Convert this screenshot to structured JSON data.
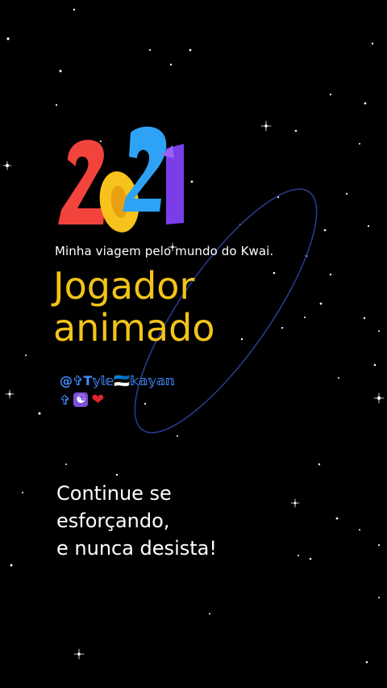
{
  "logo": {
    "year_digits": [
      "2",
      "0",
      "2",
      "1"
    ],
    "colors": [
      "#f2433d",
      "#f7c21c",
      "#2ea3f5",
      "#7a3ee8"
    ]
  },
  "header": {
    "subtitle": "Minha viagem pelo mundo do Kwai."
  },
  "title": {
    "line1": "Jogador",
    "line2": "animado"
  },
  "user": {
    "handle": "@✞T𝕪𝕝𝕖🇪🇪𝕜𝕒𝕪𝕒𝕟",
    "icon_names": [
      "cross-icon",
      "yin-yang-icon",
      "heart-icon"
    ],
    "cross": "✞",
    "yinyang": "☯",
    "heart": "❤"
  },
  "message": {
    "line1": "Continue se",
    "line2": "esforçando,",
    "line3": "e nunca desista!"
  },
  "colors": {
    "background": "#000000",
    "title": "#f2c418",
    "handle": "#3f8cff",
    "orbit": "#2a3a8a"
  }
}
